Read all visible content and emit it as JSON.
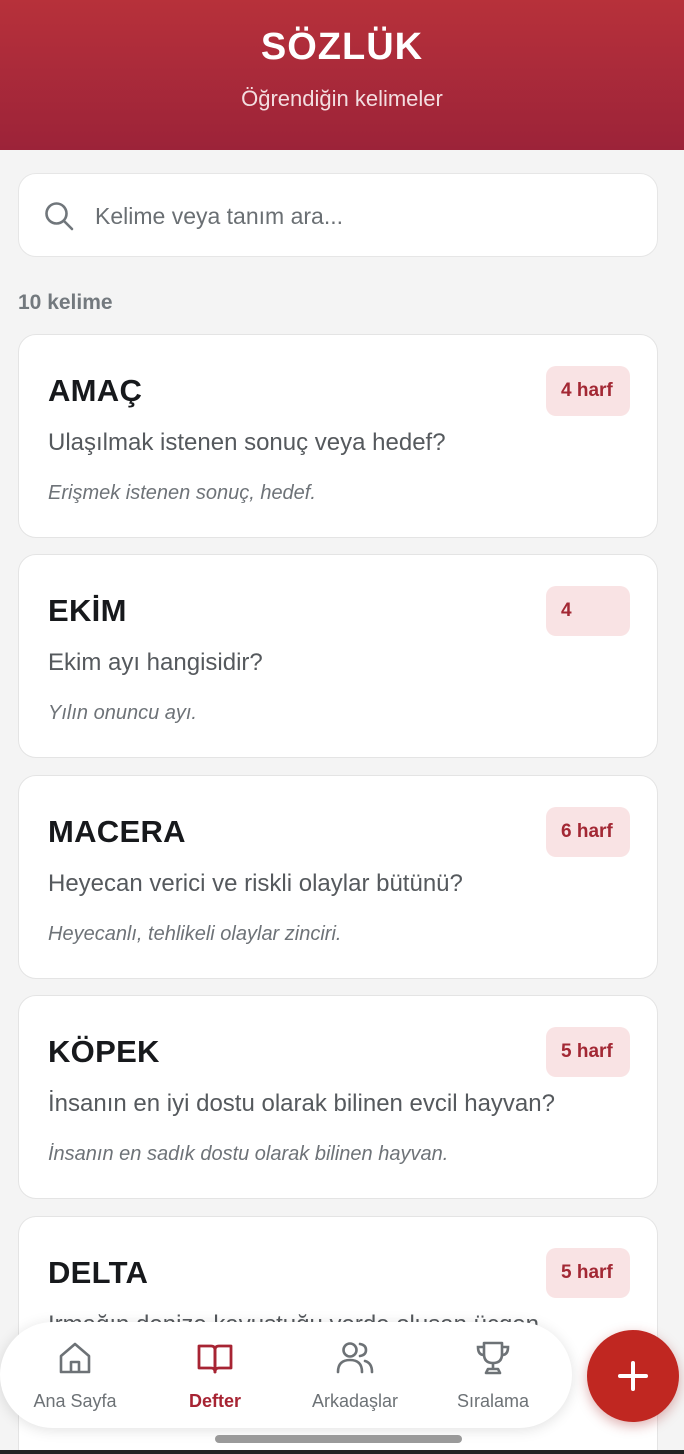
{
  "header": {
    "title": "SÖZLÜK",
    "subtitle": "Öğrendiğin kelimeler"
  },
  "search": {
    "value": "",
    "placeholder": "Kelime veya tanım ara...",
    "icon": "search-icon"
  },
  "count_label": "10 kelime",
  "cards": [
    {
      "word": "AMAÇ",
      "badge": "4 harf",
      "question": "Ulaşılmak istenen sonuç veya hedef?",
      "answer": "Erişmek istenen sonuç, hedef."
    },
    {
      "word": "EKİM",
      "badge": "4",
      "question": "Ekim ayı hangisidir?",
      "answer": "Yılın onuncu ayı."
    },
    {
      "word": "MACERA",
      "badge": "6 harf",
      "question": "Heyecan verici ve riskli olaylar bütünü?",
      "answer": "Heyecanlı, tehlikeli olaylar zinciri."
    },
    {
      "word": "KÖPEK",
      "badge": "5 harf",
      "question": "İnsanın en iyi dostu olarak bilinen evcil hayvan?",
      "answer": "İnsanın en sadık dostu olarak bilinen hayvan."
    },
    {
      "word": "DELTA",
      "badge": "5 harf",
      "question": "Irmağın denize kavuştuğu yerde oluşan üçgen",
      "answer": ""
    }
  ],
  "nav": {
    "items": [
      {
        "label": "Ana Sayfa",
        "icon": "home-icon",
        "active": false
      },
      {
        "label": "Defter",
        "icon": "book-icon",
        "active": true
      },
      {
        "label": "Arkadaşlar",
        "icon": "friends-icon",
        "active": false
      },
      {
        "label": "Sıralama",
        "icon": "trophy-icon",
        "active": false
      }
    ]
  },
  "fab": {
    "icon": "plus-icon"
  },
  "colors": {
    "brand": "#b7313a",
    "active_nav": "#a72433",
    "fab": "#c02721",
    "badge_bg": "#f9e3e4"
  }
}
